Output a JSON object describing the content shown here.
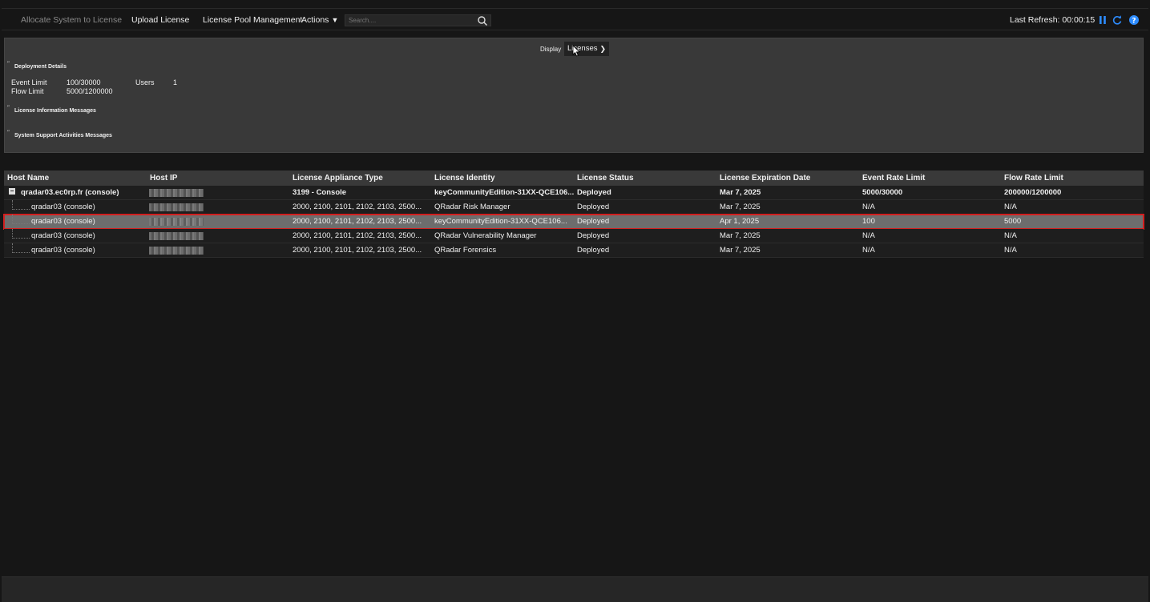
{
  "toolbar": {
    "allocate_label": "Allocate System to License",
    "upload_label": "Upload License",
    "pool_label": "License Pool Management",
    "actions_label": "Actions",
    "actions_caret": "▼",
    "search_placeholder": "Search....",
    "last_refresh": "Last Refresh: 00:00:15",
    "icons": [
      "search-icon",
      "pause-icon",
      "refresh-icon",
      "help-icon"
    ],
    "accent_color": "#2d8cff"
  },
  "summary": {
    "display_label": "Display",
    "display_value": "Licenses",
    "deployment_details": "Deployment Details",
    "event_limit_label": "Event Limit",
    "event_limit_value": "100/30000",
    "flow_limit_label": "Flow Limit",
    "flow_limit_value": "5000/1200000",
    "users_label": "Users",
    "users_value": "1",
    "license_info_messages": "License Information Messages",
    "support_messages": "System Support Activities Messages"
  },
  "table": {
    "columns": [
      "Host Name",
      "Host IP",
      "License Appliance Type",
      "License Identity",
      "License Status",
      "License Expiration Date",
      "Event Rate Limit",
      "Flow Rate Limit"
    ],
    "rows": [
      {
        "host": "qradar03.ec0rp.fr (console)",
        "type": "3199 - Console",
        "identity": "keyCommunityEdition-31XX-QCE106...",
        "status": "Deployed",
        "expiration": "Mar 7, 2025",
        "event_rate": "5000/30000",
        "flow_rate": "200000/1200000"
      },
      {
        "host": "qradar03 (console)",
        "type": "2000, 2100, 2101, 2102, 2103, 2500...",
        "identity": "QRadar Risk Manager",
        "status": "Deployed",
        "expiration": "Mar 7, 2025",
        "event_rate": "N/A",
        "flow_rate": "N/A"
      },
      {
        "host": "qradar03 (console)",
        "type": "2000, 2100, 2101, 2102, 2103, 2500...",
        "identity": "keyCommunityEdition-31XX-QCE106...",
        "status": "Deployed",
        "expiration": "Apr 1, 2025",
        "event_rate": "100",
        "flow_rate": "5000"
      },
      {
        "host": "qradar03 (console)",
        "type": "2000, 2100, 2101, 2102, 2103, 2500...",
        "identity": "QRadar Vulnerability Manager",
        "status": "Deployed",
        "expiration": "Mar 7, 2025",
        "event_rate": "N/A",
        "flow_rate": "N/A"
      },
      {
        "host": "qradar03 (console)",
        "type": "2000, 2100, 2101, 2102, 2103, 2500...",
        "identity": "QRadar Forensics",
        "status": "Deployed",
        "expiration": "Mar 7, 2025",
        "event_rate": "N/A",
        "flow_rate": "N/A"
      }
    ],
    "selected_highlight_color": "#d21f1f"
  }
}
